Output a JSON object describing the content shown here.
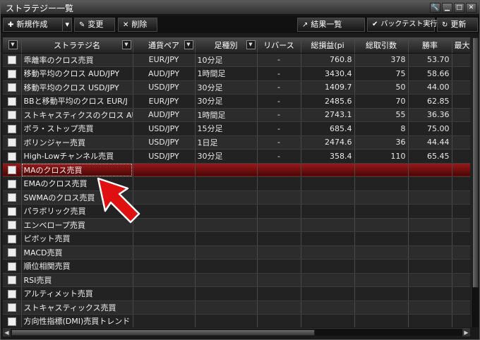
{
  "window": {
    "title": "ストラテジー一覧"
  },
  "toolbar": {
    "new_label": "新規作成",
    "edit_label": "変更",
    "delete_label": "削除",
    "results_label": "結果一覧",
    "backtest_label": "バックテスト実行",
    "refresh_label": "更新"
  },
  "columns": [
    "ストラテジ名",
    "通貨ペア",
    "足種別",
    "リバース",
    "総損益(pi",
    "総取引数",
    "勝率",
    "最大"
  ],
  "rows": [
    {
      "name": "乖離率のクロス売買",
      "pair": "EUR/JPY",
      "period": "10分足",
      "rev": "-",
      "pl": "760.8",
      "trades": "378",
      "win": "53.70"
    },
    {
      "name": "移動平均のクロス AUD/JPY",
      "pair": "AUD/JPY",
      "period": "1時間足",
      "rev": "-",
      "pl": "3430.4",
      "trades": "75",
      "win": "58.66"
    },
    {
      "name": "移動平均のクロス USD/JPY",
      "pair": "USD/JPY",
      "period": "30分足",
      "rev": "-",
      "pl": "1409.7",
      "trades": "50",
      "win": "44.00"
    },
    {
      "name": "BBと移動平均のクロス EUR/J",
      "pair": "EUR/JPY",
      "period": "30分足",
      "rev": "-",
      "pl": "2485.6",
      "trades": "70",
      "win": "62.85"
    },
    {
      "name": "ストキャスティクスのクロス AU",
      "pair": "AUD/JPY",
      "period": "1時間足",
      "rev": "-",
      "pl": "2743.1",
      "trades": "55",
      "win": "36.36"
    },
    {
      "name": "ボラ・ストップ売買",
      "pair": "USD/JPY",
      "period": "15分足",
      "rev": "-",
      "pl": "685.4",
      "trades": "8",
      "win": "75.00"
    },
    {
      "name": "ボリンジャー売買",
      "pair": "USD/JPY",
      "period": "1日足",
      "rev": "-",
      "pl": "2474.6",
      "trades": "36",
      "win": "44.44"
    },
    {
      "name": "High-Lowチャンネル売買",
      "pair": "USD/JPY",
      "period": "30分足",
      "rev": "-",
      "pl": "358.4",
      "trades": "110",
      "win": "65.45"
    },
    {
      "name": "MAのクロス売買",
      "pair": "",
      "period": "",
      "rev": "",
      "pl": "",
      "trades": "",
      "win": ""
    },
    {
      "name": "EMAのクロス売買",
      "pair": "",
      "period": "",
      "rev": "",
      "pl": "",
      "trades": "",
      "win": ""
    },
    {
      "name": "SWMAのクロス売買",
      "pair": "",
      "period": "",
      "rev": "",
      "pl": "",
      "trades": "",
      "win": ""
    },
    {
      "name": "パラボリック売買",
      "pair": "",
      "period": "",
      "rev": "",
      "pl": "",
      "trades": "",
      "win": ""
    },
    {
      "name": "エンベロープ売買",
      "pair": "",
      "period": "",
      "rev": "",
      "pl": "",
      "trades": "",
      "win": ""
    },
    {
      "name": "ピボット売買",
      "pair": "",
      "period": "",
      "rev": "",
      "pl": "",
      "trades": "",
      "win": ""
    },
    {
      "name": "MACD売買",
      "pair": "",
      "period": "",
      "rev": "",
      "pl": "",
      "trades": "",
      "win": ""
    },
    {
      "name": "順位相関売買",
      "pair": "",
      "period": "",
      "rev": "",
      "pl": "",
      "trades": "",
      "win": ""
    },
    {
      "name": "RSI売買",
      "pair": "",
      "period": "",
      "rev": "",
      "pl": "",
      "trades": "",
      "win": ""
    },
    {
      "name": "アルティメット売買",
      "pair": "",
      "period": "",
      "rev": "",
      "pl": "",
      "trades": "",
      "win": ""
    },
    {
      "name": "ストキャスティックス売買",
      "pair": "",
      "period": "",
      "rev": "",
      "pl": "",
      "trades": "",
      "win": ""
    },
    {
      "name": "方向性指標(DMI)売買トレンド",
      "pair": "",
      "period": "",
      "rev": "",
      "pl": "",
      "trades": "",
      "win": ""
    }
  ],
  "selected_row": 8,
  "colors": {
    "selected": "#8b1414",
    "pointer": "#e01010"
  }
}
